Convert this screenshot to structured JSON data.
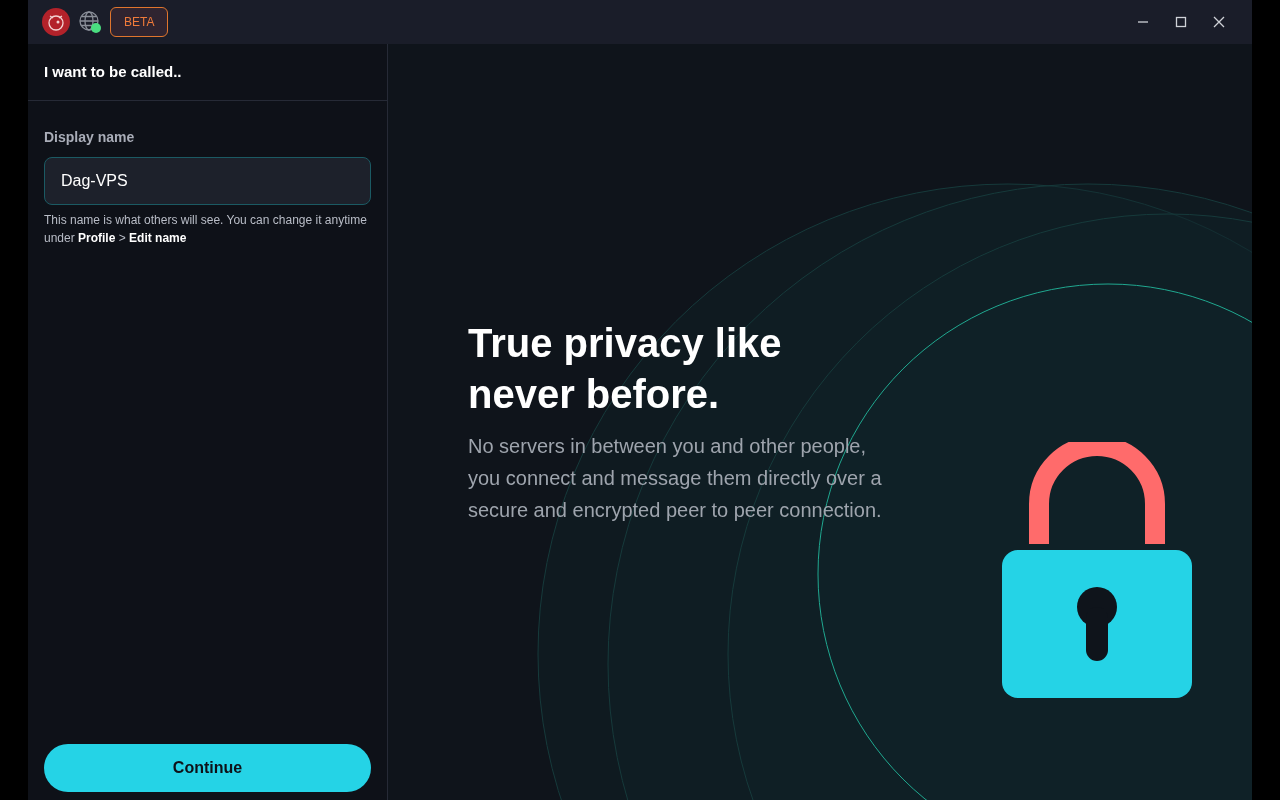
{
  "title_bar": {
    "badge": "BETA",
    "network_online": true
  },
  "panel": {
    "heading": "I want to be called..",
    "field_label": "Display name",
    "field_value": "Dag-VPS",
    "hint": "This name is what others will see. You can change it anytime under **Profile** > **Edit name**",
    "button": "Continue"
  },
  "hero": {
    "title": "True privacy like never before.",
    "body": "No servers in between you and other people, you connect and message them directly over a secure and encrypted peer to peer connection."
  }
}
